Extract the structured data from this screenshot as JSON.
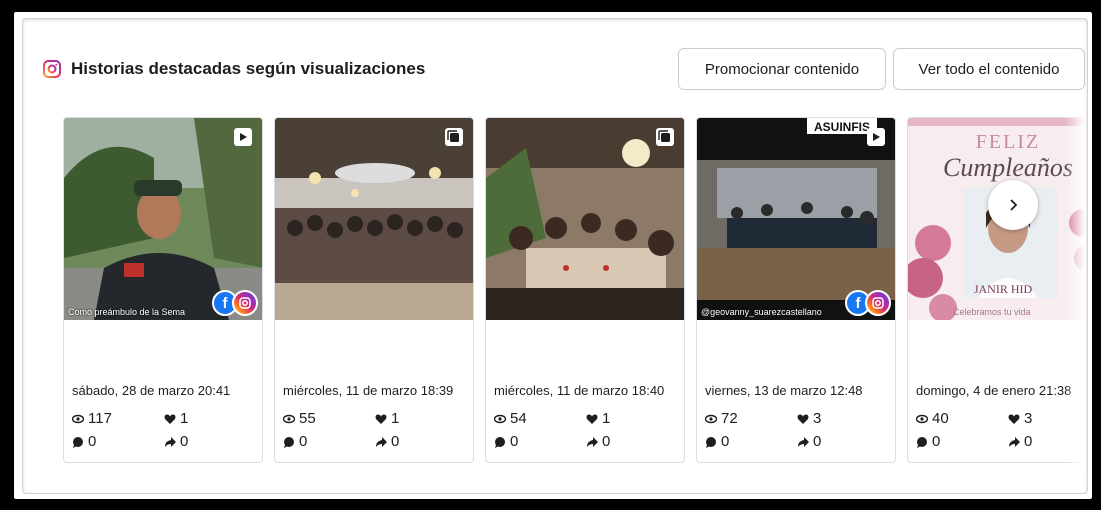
{
  "header": {
    "title": "Historias destacadas según visualizaciones",
    "icon": "instagram-icon",
    "accent": "#e1306c"
  },
  "buttons": {
    "promote": "Promocionar contenido",
    "view_all": "Ver todo el contenido"
  },
  "stories": [
    {
      "date": "sábado, 28 de marzo 20:41",
      "views": "117",
      "likes": "1",
      "comments": "0",
      "shares": "0",
      "type_icon": "video-icon",
      "overlay_text": "Como preámbulo de la Sema",
      "platforms": [
        "facebook",
        "instagram"
      ]
    },
    {
      "date": "miércoles, 11 de marzo 18:39",
      "views": "55",
      "likes": "1",
      "comments": "0",
      "shares": "0",
      "type_icon": "carousel-icon",
      "overlay_text": "",
      "platforms": []
    },
    {
      "date": "miércoles, 11 de marzo 18:40",
      "views": "54",
      "likes": "1",
      "comments": "0",
      "shares": "0",
      "type_icon": "carousel-icon",
      "overlay_text": "",
      "platforms": []
    },
    {
      "date": "viernes, 13 de marzo 12:48",
      "views": "72",
      "likes": "3",
      "comments": "0",
      "shares": "0",
      "type_icon": "video-icon",
      "overlay_text": "@geovanny_suarezcastellano",
      "top_text": "ASUINFIS",
      "platforms": [
        "facebook",
        "instagram"
      ]
    },
    {
      "date": "domingo, 4 de enero 21:38",
      "views": "40",
      "likes": "3",
      "comments": "0",
      "shares": "0",
      "type_icon": "",
      "overlay_text": "Celebramos tu vida",
      "feliz": "FELIZ",
      "cumple": "Cumpleaños",
      "name_text": "JANIR HID",
      "platforms": []
    }
  ]
}
